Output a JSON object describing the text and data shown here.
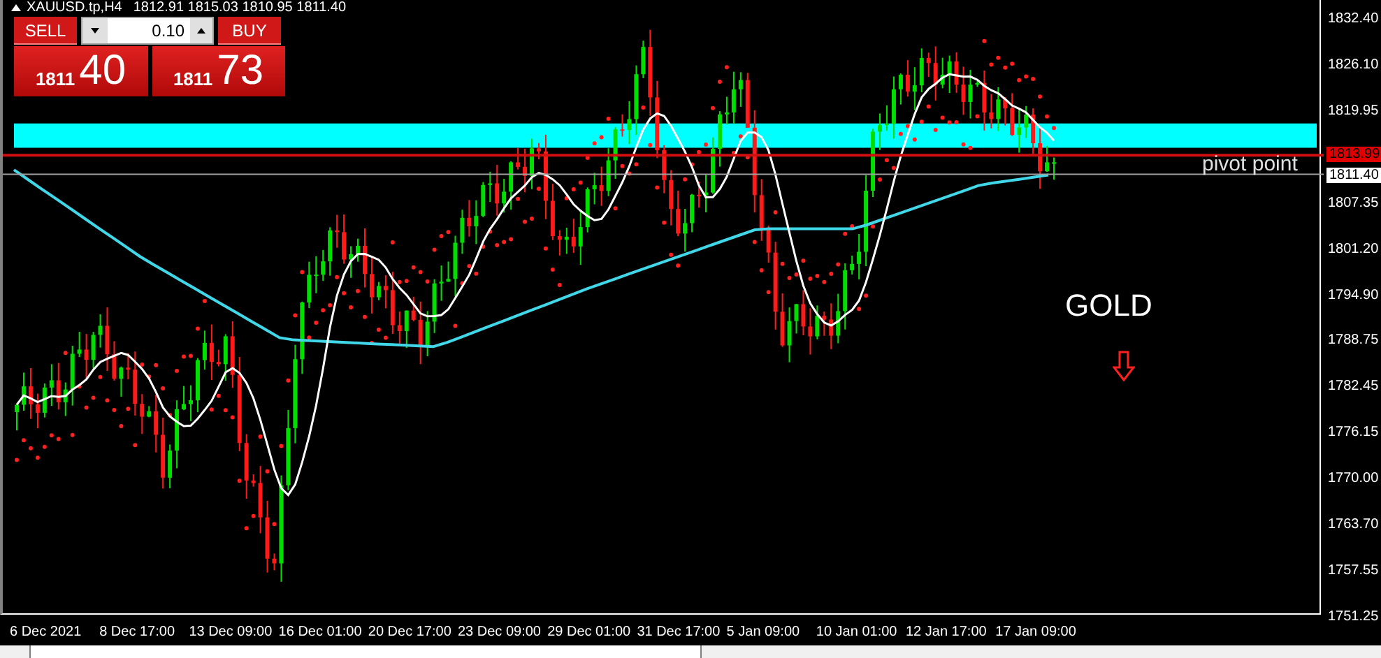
{
  "symbol_bar": {
    "expanded": true,
    "symbol": "XAUUSD.tp,H4",
    "ohlc": [
      "1812.91",
      "1815.03",
      "1810.95",
      "1811.40"
    ]
  },
  "trade_panel": {
    "sell_label": "SELL",
    "buy_label": "BUY",
    "volume": "0.10",
    "sell_price": {
      "handle": "1811",
      "pips": "40"
    },
    "buy_price": {
      "handle": "1811",
      "pips": "73"
    }
  },
  "price_axis": {
    "labels": [
      "1832.40",
      "1826.10",
      "1819.95",
      "1807.35",
      "1801.20",
      "1794.90",
      "1788.75",
      "1782.45",
      "1776.15",
      "1770.00",
      "1763.70",
      "1757.55",
      "1751.25"
    ],
    "ask_line": "1813.99",
    "bid_line": "1811.40"
  },
  "time_axis": {
    "labels": [
      "6 Dec 2021",
      "8 Dec 17:00",
      "13 Dec 09:00",
      "16 Dec 01:00",
      "20 Dec 17:00",
      "23 Dec 09:00",
      "29 Dec 01:00",
      "31 Dec 17:00",
      "5 Jan 09:00",
      "10 Jan 01:00",
      "12 Jan 17:00",
      "17 Jan 09:00"
    ]
  },
  "annotations": {
    "pivot_label": "pivot point",
    "title": "GOLD"
  }
}
